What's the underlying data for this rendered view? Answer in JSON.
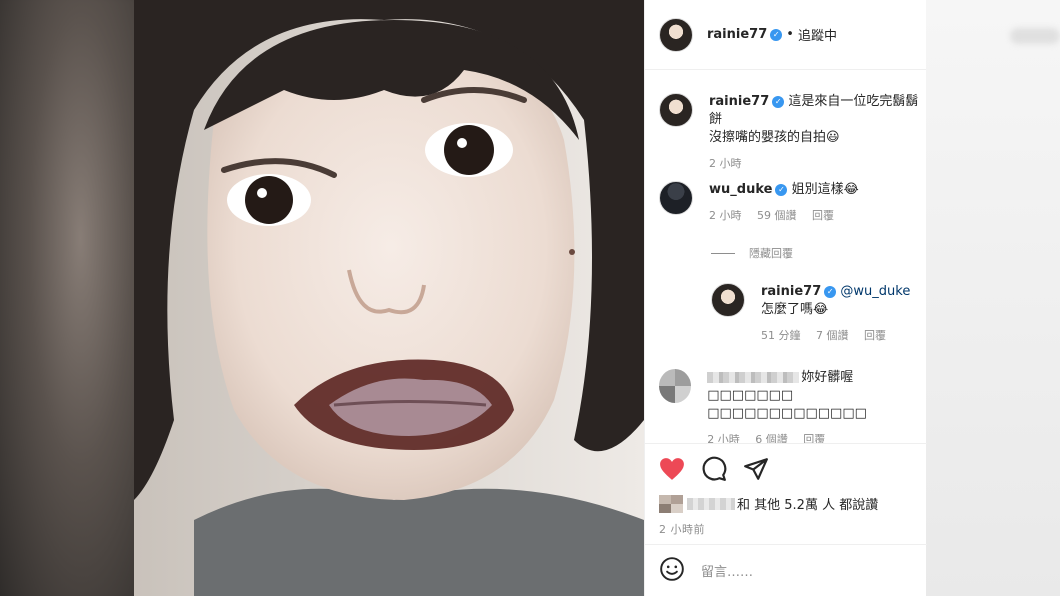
{
  "post": {
    "author": "rainie77",
    "follow_status": "追蹤中",
    "separator": "•"
  },
  "comments": [
    {
      "user": "rainie77",
      "verified": true,
      "text_line1": "這是來自一位吃完鬍鬍餅",
      "text_line2": "沒擦嘴的嬰孩的自拍😃",
      "time": "2 小時"
    },
    {
      "user": "wu_duke",
      "verified": true,
      "text": "姐別這樣😂",
      "time": "2 小時",
      "likes": "59 個讚",
      "reply": "回覆"
    },
    {
      "user": "rainie77",
      "verified": true,
      "mention": "@wu_duke",
      "text": "怎麼了嗎😂",
      "time": "51 分鐘",
      "likes": "7 個讚",
      "reply": "回覆"
    },
    {
      "user_hidden": true,
      "text_line1": "妳好髒喔□□□□□□□",
      "text_line2": "□□□□□□□□□□□□□",
      "time": "2 小時",
      "likes": "6 個讚",
      "reply": "回覆"
    }
  ],
  "hide_replies": "隱藏回覆",
  "likes_summary": "和 其他 5.2萬 人 都說讚",
  "posted_ago": "2 小時前",
  "comment_placeholder": "留言……",
  "icons": [
    "heart-icon",
    "comment-icon",
    "share-icon",
    "emoji-icon",
    "verified-icon"
  ],
  "colors": {
    "heart": "#ed4956",
    "verified": "#3897f0",
    "mention": "#00376b",
    "meta": "#8e8e8e"
  }
}
